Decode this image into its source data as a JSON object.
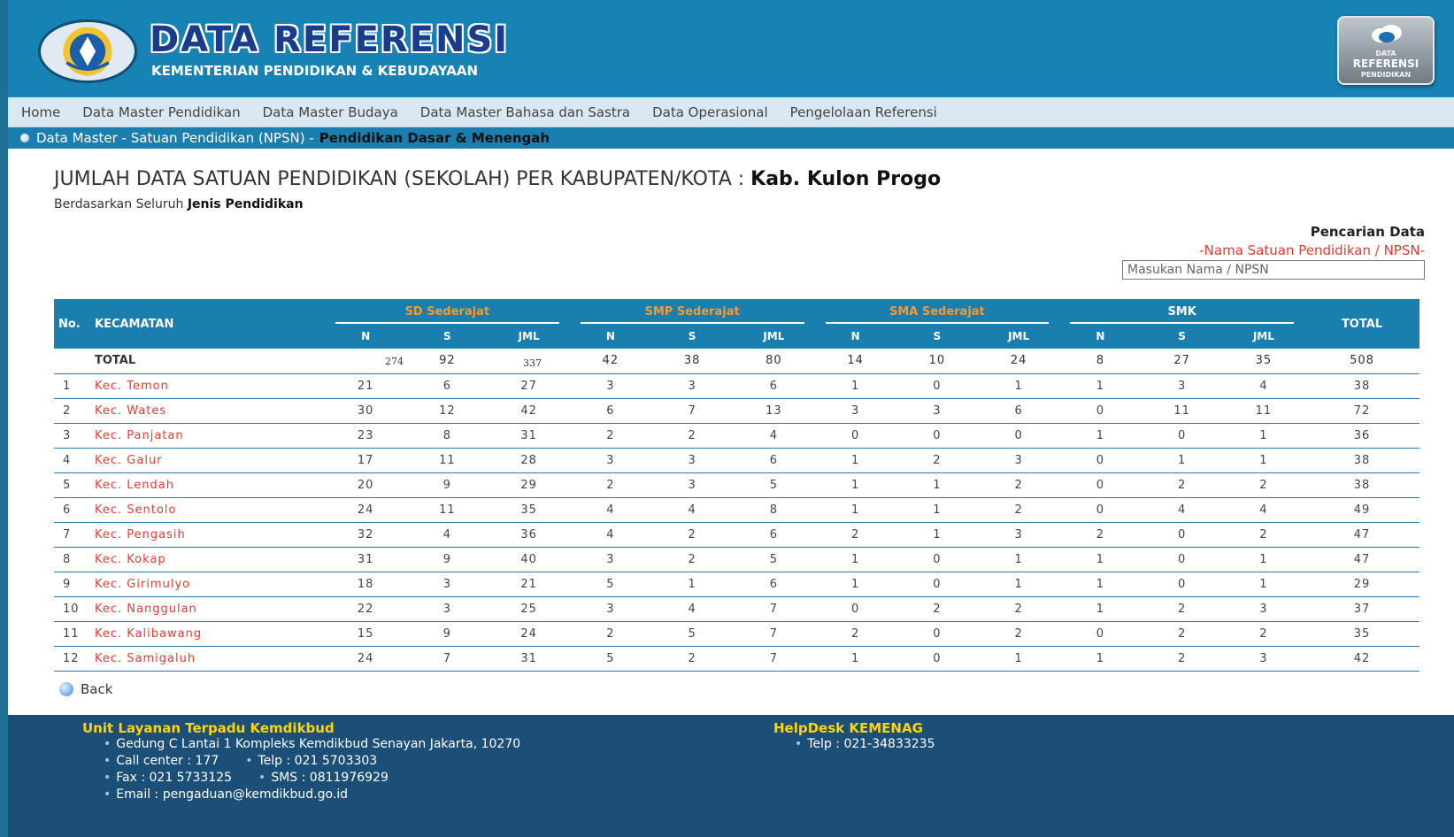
{
  "header": {
    "title": "DATA REFERENSI",
    "subtitle": "KEMENTERIAN PENDIDIKAN & KEBUDAYAAN",
    "badge": {
      "line1": "DATA",
      "line2": "REFERENSI",
      "line3": "PENDIDIKAN"
    }
  },
  "nav": {
    "items": [
      "Home",
      "Data Master Pendidikan",
      "Data Master Budaya",
      "Data Master Bahasa dan Sastra",
      "Data Operasional",
      "Pengelolaan Referensi"
    ]
  },
  "breadcrumb": {
    "prefix": "Data Master - Satuan Pendidikan (NPSN) -",
    "current": "Pendidikan Dasar & Menengah"
  },
  "page": {
    "heading": "JUMLAH DATA SATUAN PENDIDIKAN (SEKOLAH) PER KABUPATEN/KOTA :",
    "heading_region": "Kab. Kulon Progo",
    "sub_prefix": "Berdasarkan Seluruh",
    "sub_strong": "Jenis Pendidikan"
  },
  "search": {
    "title": "Pencarian Data",
    "hint": "-Nama Satuan Pendidikan / NPSN-",
    "placeholder": "Masukan Nama / NPSN"
  },
  "table": {
    "col_no": "No.",
    "col_kecamatan": "KECAMATAN",
    "col_total": "TOTAL",
    "groups": [
      "SD Sederajat",
      "SMP Sederajat",
      "SMA Sederajat",
      "SMK"
    ],
    "sub": [
      "N",
      "S",
      "JML"
    ],
    "total_label": "TOTAL",
    "totals": {
      "sd_n": "274",
      "sd_s": "92",
      "sd_jml": "337",
      "smp_n": "42",
      "smp_s": "38",
      "smp_jml": "80",
      "sma_n": "14",
      "sma_s": "10",
      "sma_jml": "24",
      "smk_n": "8",
      "smk_s": "27",
      "smk_jml": "35",
      "total": "508"
    },
    "rows": [
      {
        "no": "1",
        "kecamatan": "Kec. Temon",
        "v": [
          "21",
          "6",
          "27",
          "3",
          "3",
          "6",
          "1",
          "0",
          "1",
          "1",
          "3",
          "4",
          "38"
        ]
      },
      {
        "no": "2",
        "kecamatan": "Kec. Wates",
        "v": [
          "30",
          "12",
          "42",
          "6",
          "7",
          "13",
          "3",
          "3",
          "6",
          "0",
          "11",
          "11",
          "72"
        ]
      },
      {
        "no": "3",
        "kecamatan": "Kec. Panjatan",
        "v": [
          "23",
          "8",
          "31",
          "2",
          "2",
          "4",
          "0",
          "0",
          "0",
          "1",
          "0",
          "1",
          "36"
        ]
      },
      {
        "no": "4",
        "kecamatan": "Kec. Galur",
        "v": [
          "17",
          "11",
          "28",
          "3",
          "3",
          "6",
          "1",
          "2",
          "3",
          "0",
          "1",
          "1",
          "38"
        ]
      },
      {
        "no": "5",
        "kecamatan": "Kec. Lendah",
        "v": [
          "20",
          "9",
          "29",
          "2",
          "3",
          "5",
          "1",
          "1",
          "2",
          "0",
          "2",
          "2",
          "38"
        ]
      },
      {
        "no": "6",
        "kecamatan": "Kec. Sentolo",
        "v": [
          "24",
          "11",
          "35",
          "4",
          "4",
          "8",
          "1",
          "1",
          "2",
          "0",
          "4",
          "4",
          "49"
        ]
      },
      {
        "no": "7",
        "kecamatan": "Kec. Pengasih",
        "v": [
          "32",
          "4",
          "36",
          "4",
          "2",
          "6",
          "2",
          "1",
          "3",
          "2",
          "0",
          "2",
          "47"
        ]
      },
      {
        "no": "8",
        "kecamatan": "Kec. Kokap",
        "v": [
          "31",
          "9",
          "40",
          "3",
          "2",
          "5",
          "1",
          "0",
          "1",
          "1",
          "0",
          "1",
          "47"
        ]
      },
      {
        "no": "9",
        "kecamatan": "Kec. Girimulyo",
        "v": [
          "18",
          "3",
          "21",
          "5",
          "1",
          "6",
          "1",
          "0",
          "1",
          "1",
          "0",
          "1",
          "29"
        ]
      },
      {
        "no": "10",
        "kecamatan": "Kec. Nanggulan",
        "v": [
          "22",
          "3",
          "25",
          "3",
          "4",
          "7",
          "0",
          "2",
          "2",
          "1",
          "2",
          "3",
          "37"
        ]
      },
      {
        "no": "11",
        "kecamatan": "Kec. Kalibawang",
        "v": [
          "15",
          "9",
          "24",
          "2",
          "5",
          "7",
          "2",
          "0",
          "2",
          "0",
          "2",
          "2",
          "35"
        ]
      },
      {
        "no": "12",
        "kecamatan": "Kec. Samigaluh",
        "v": [
          "24",
          "7",
          "31",
          "5",
          "2",
          "7",
          "1",
          "0",
          "1",
          "1",
          "2",
          "3",
          "42"
        ]
      }
    ]
  },
  "back": {
    "label": "Back"
  },
  "footer": {
    "col1": {
      "title": "Unit Layanan Terpadu Kemdikbud",
      "address": "Gedung C Lantai 1 Kompleks Kemdikbud Senayan Jakarta, 10270",
      "callcenter": "Call center : 177",
      "telp": "Telp : 021 5703303",
      "fax": "Fax : 021 5733125",
      "sms": "SMS : 0811976929",
      "email": "Email : pengaduan@kemdikbud.go.id"
    },
    "col2": {
      "title": "HelpDesk KEMENAG",
      "telp": "Telp : 021-34833235"
    }
  },
  "colors": {
    "header_blue": "#1683b4",
    "nav_bg": "#d9e8f3",
    "table_header": "#1a7fae",
    "orange_group": "#f59a2e",
    "link_red": "#e53a2e",
    "footer_bg": "#1b4f78",
    "footer_title": "#ffd400"
  }
}
